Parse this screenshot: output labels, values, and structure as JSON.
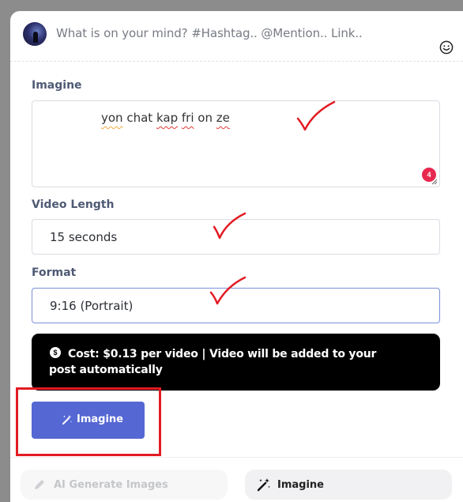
{
  "composer": {
    "placeholder": "What is on your mind? #Hashtag.. @Mention.. Link.."
  },
  "imagine_field": {
    "label": "Imagine",
    "words": [
      "yon",
      "chat",
      "kap",
      "fri",
      "on",
      "ze"
    ],
    "badge_count": "4"
  },
  "video_length": {
    "label": "Video Length",
    "value": "15 seconds"
  },
  "format": {
    "label": "Format",
    "value": "9:16 (Portrait)"
  },
  "cost_notice": {
    "icon": "dollar-icon",
    "text": "Cost: $0.13 per video | Video will be added to your post automatically"
  },
  "imagine_button": {
    "icon": "magic-wand-icon",
    "label": "Imagine"
  },
  "tabs": [
    {
      "label": "AI Generate Images",
      "icon": "pencil-icon",
      "active": false
    },
    {
      "label": "Imagine",
      "icon": "magic-wand-icon",
      "active": true
    }
  ],
  "colors": {
    "button": "#5567d3",
    "annotation": "#e31b23",
    "badge": "#e8294f",
    "label": "#4f5a74"
  }
}
